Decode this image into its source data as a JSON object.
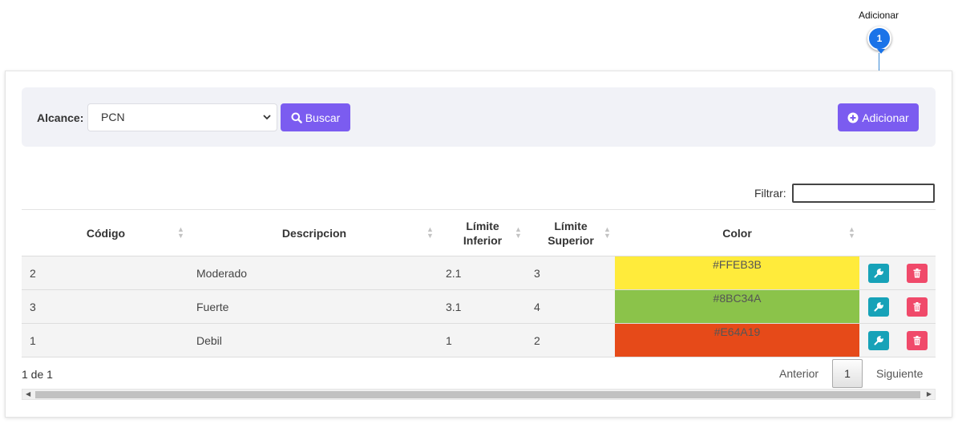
{
  "callout": {
    "label": "Adicionar",
    "number": "1"
  },
  "toolbar": {
    "scope_label": "Alcance:",
    "scope_value": "PCN",
    "search_label": "Buscar",
    "add_label": "Adicionar"
  },
  "filter": {
    "label": "Filtrar:",
    "value": ""
  },
  "table": {
    "headers": {
      "code": "Código",
      "description": "Descripcion",
      "lower_line1": "Límite",
      "lower_line2": "Inferior",
      "upper_line1": "Límite",
      "upper_line2": "Superior",
      "color": "Color"
    },
    "rows": [
      {
        "code": "2",
        "description": "Moderado",
        "lower": "2.1",
        "upper": "3",
        "color": "#FFEB3B"
      },
      {
        "code": "3",
        "description": "Fuerte",
        "lower": "3.1",
        "upper": "4",
        "color": "#8BC34A"
      },
      {
        "code": "1",
        "description": "Debil",
        "lower": "1",
        "upper": "2",
        "color": "#E64A19"
      }
    ]
  },
  "pagination": {
    "info": "1 de 1",
    "prev": "Anterior",
    "current": "1",
    "next": "Siguiente"
  },
  "colors": {
    "accent": "#7b5cf0",
    "edit": "#17a2b8",
    "delete": "#f04a6a",
    "callout": "#1a73e8"
  }
}
